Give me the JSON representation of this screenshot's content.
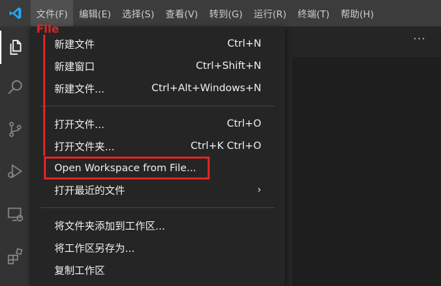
{
  "menubar": {
    "items": [
      "文件(F)",
      "编辑(E)",
      "选择(S)",
      "查看(V)",
      "转到(G)",
      "运行(R)",
      "终端(T)",
      "帮助(H)"
    ]
  },
  "annotation": {
    "label": "File"
  },
  "editor": {
    "more_label": "···"
  },
  "file_menu": {
    "items": [
      {
        "label": "新建文件",
        "shortcut": "Ctrl+N"
      },
      {
        "label": "新建窗口",
        "shortcut": "Ctrl+Shift+N"
      },
      {
        "label": "新建文件...",
        "shortcut": "Ctrl+Alt+Windows+N"
      },
      {
        "label": "打开文件...",
        "shortcut": "Ctrl+O"
      },
      {
        "label": "打开文件夹...",
        "shortcut": "Ctrl+K Ctrl+O"
      },
      {
        "label": "Open Workspace from File...",
        "shortcut": ""
      },
      {
        "label": "打开最近的文件",
        "shortcut": "›"
      },
      {
        "label": "将文件夹添加到工作区...",
        "shortcut": ""
      },
      {
        "label": "将工作区另存为...",
        "shortcut": ""
      },
      {
        "label": "复制工作区",
        "shortcut": ""
      }
    ]
  },
  "colors": {
    "accent": "#0078d4",
    "annotation": "#e02424"
  }
}
